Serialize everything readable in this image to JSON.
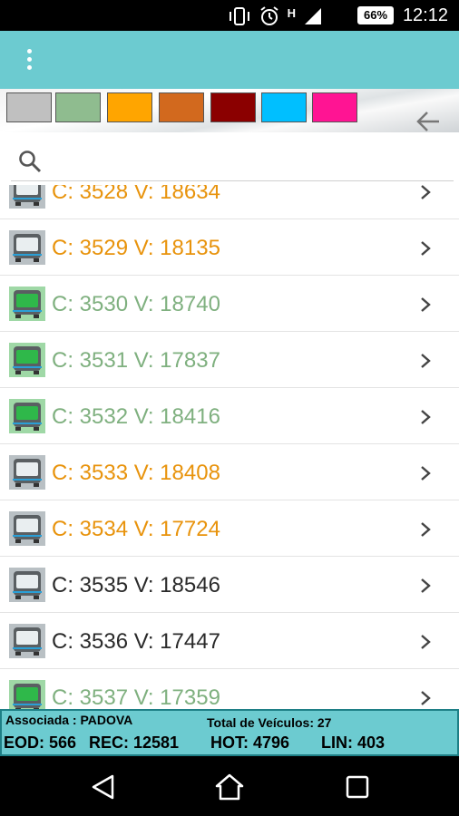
{
  "status_bar": {
    "time": "12:12",
    "battery": "66%",
    "network": "H"
  },
  "color_filters": [
    {
      "name": "gray",
      "color": "#c0c0c0"
    },
    {
      "name": "green",
      "color": "#8fbc8f"
    },
    {
      "name": "orange",
      "color": "#ffa500"
    },
    {
      "name": "dark-orange",
      "color": "#d2691e"
    },
    {
      "name": "dark-red",
      "color": "#8b0000"
    },
    {
      "name": "sky-blue",
      "color": "#00bfff"
    },
    {
      "name": "pink",
      "color": "#ff1493"
    }
  ],
  "search": {
    "placeholder": ""
  },
  "vehicles": [
    {
      "label": "C: 3528 V: 18634",
      "status": "orange",
      "color": "#e8930c"
    },
    {
      "label": "C: 3529 V: 18135",
      "status": "orange",
      "color": "#e8930c"
    },
    {
      "label": "C: 3530 V: 18740",
      "status": "green",
      "color": "#7fb07f"
    },
    {
      "label": "C: 3531 V: 17837",
      "status": "green",
      "color": "#7fb07f"
    },
    {
      "label": "C: 3532 V: 18416",
      "status": "green",
      "color": "#7fb07f"
    },
    {
      "label": "C: 3533 V: 18408",
      "status": "orange",
      "color": "#e8930c"
    },
    {
      "label": "C: 3534 V: 17724",
      "status": "orange",
      "color": "#e8930c"
    },
    {
      "label": "C: 3535 V: 18546",
      "status": "gray",
      "color": "#2a2a2a"
    },
    {
      "label": "C: 3536 V: 17447",
      "status": "gray",
      "color": "#2a2a2a"
    },
    {
      "label": "C: 3537 V: 17359",
      "status": "green",
      "color": "#7fb07f"
    }
  ],
  "footer": {
    "associada": "Associada : PADOVA",
    "total": "Total de Veículos: 27",
    "eod": "EOD: 566",
    "rec": "REC: 12581",
    "hot": "HOT: 4796",
    "lin": "LIN: 403"
  }
}
